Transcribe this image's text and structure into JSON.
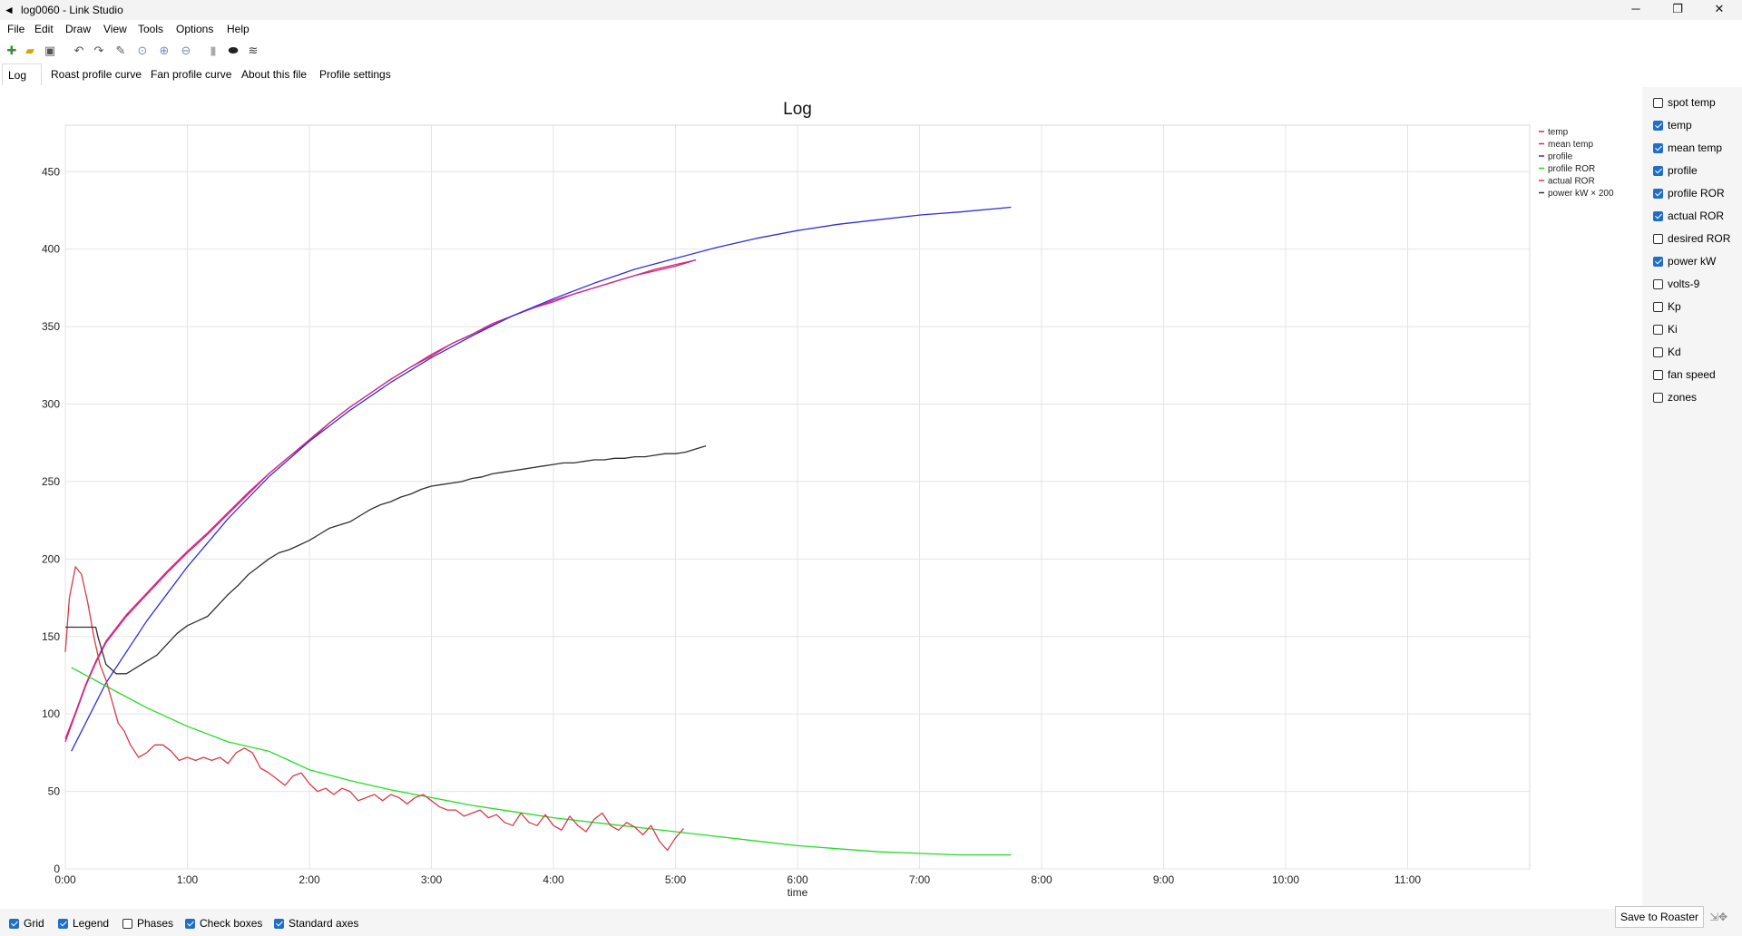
{
  "window": {
    "title": "log0060 - Link Studio",
    "app_icon": "back-arrow-icon",
    "minimize_glyph": "─",
    "maximize_glyph": "❐",
    "close_glyph": "✕"
  },
  "menu": [
    "File",
    "Edit",
    "Draw",
    "View",
    "Tools",
    "Options",
    "Help"
  ],
  "toolbar_icons": [
    "new-file-icon",
    "open-folder-icon",
    "save-icon",
    "undo-icon",
    "redo-icon",
    "tools-icon",
    "zoom-icon",
    "zoom-in-icon",
    "zoom-out-icon",
    "divider-icon",
    "bean-icon",
    "steam-icon"
  ],
  "tabs": [
    {
      "label": "Log",
      "active": true
    },
    {
      "label": "Roast profile curve",
      "active": false
    },
    {
      "label": "Fan profile curve",
      "active": false
    },
    {
      "label": "About this file",
      "active": false
    },
    {
      "label": "Profile settings",
      "active": false
    }
  ],
  "side_checkboxes": [
    {
      "label": "spot temp",
      "checked": false
    },
    {
      "label": "temp",
      "checked": true
    },
    {
      "label": "mean temp",
      "checked": true
    },
    {
      "label": "profile",
      "checked": true
    },
    {
      "label": "profile ROR",
      "checked": true
    },
    {
      "label": "actual ROR",
      "checked": true
    },
    {
      "label": "desired ROR",
      "checked": false
    },
    {
      "label": "power kW",
      "checked": true
    },
    {
      "label": "volts-9",
      "checked": false
    },
    {
      "label": "Kp",
      "checked": false
    },
    {
      "label": "Ki",
      "checked": false
    },
    {
      "label": "Kd",
      "checked": false
    },
    {
      "label": "fan speed",
      "checked": false
    },
    {
      "label": "zones",
      "checked": false
    }
  ],
  "status_checkboxes": [
    {
      "label": "Grid",
      "checked": true
    },
    {
      "label": "Legend",
      "checked": true
    },
    {
      "label": "Phases",
      "checked": false
    },
    {
      "label": "Check boxes",
      "checked": true
    },
    {
      "label": "Standard axes",
      "checked": true
    }
  ],
  "save_button": "Save to Roaster",
  "resize_icon": "resize-icon",
  "chart_data": {
    "type": "line",
    "title": "Log",
    "xlabel": "time",
    "ylabel": "",
    "xlim": [
      0,
      720
    ],
    "ylim": [
      0,
      480
    ],
    "x_ticks": [
      {
        "v": 0,
        "label": "0:00"
      },
      {
        "v": 60,
        "label": "1:00"
      },
      {
        "v": 120,
        "label": "2:00"
      },
      {
        "v": 180,
        "label": "3:00"
      },
      {
        "v": 240,
        "label": "4:00"
      },
      {
        "v": 300,
        "label": "5:00"
      },
      {
        "v": 360,
        "label": "6:00"
      },
      {
        "v": 420,
        "label": "7:00"
      },
      {
        "v": 480,
        "label": "8:00"
      },
      {
        "v": 540,
        "label": "9:00"
      },
      {
        "v": 600,
        "label": "10:00"
      },
      {
        "v": 660,
        "label": "11:00"
      }
    ],
    "y_ticks": [
      0,
      50,
      100,
      150,
      200,
      250,
      300,
      350,
      400,
      450
    ],
    "grid": true,
    "legend_position": "top-right",
    "series": [
      {
        "name": "temp",
        "color": "#e0206a",
        "x": [
          0,
          5,
          10,
          15,
          20,
          30,
          40,
          50,
          60,
          70,
          80,
          90,
          100,
          110,
          120,
          130,
          140,
          150,
          160,
          170,
          180,
          190,
          200,
          210,
          220,
          230,
          240,
          250,
          260,
          270,
          280,
          290,
          300,
          310
        ],
        "y": [
          82,
          100,
          118,
          133,
          146,
          163,
          177,
          191,
          204,
          216,
          229,
          242,
          255,
          266,
          276,
          288,
          298,
          307,
          316,
          324,
          331,
          339,
          345,
          351,
          357,
          362,
          366,
          371,
          375,
          379,
          383,
          386,
          389,
          393
        ]
      },
      {
        "name": "mean temp",
        "color": "#cc2a8a",
        "x": [
          0,
          5,
          10,
          15,
          20,
          30,
          40,
          50,
          60,
          70,
          80,
          90,
          100,
          110,
          120,
          130,
          140,
          150,
          160,
          170,
          180,
          190,
          200,
          210,
          220,
          230,
          240,
          250,
          260,
          270,
          280,
          290,
          300,
          310
        ],
        "y": [
          84,
          101,
          119,
          134,
          147,
          164,
          178,
          192,
          205,
          217,
          230,
          243,
          255,
          266,
          277,
          288,
          298,
          307,
          316,
          324,
          332,
          339,
          345,
          352,
          357,
          362,
          367,
          371,
          375,
          379,
          383,
          387,
          390,
          393
        ]
      },
      {
        "name": "profile",
        "color": "#2e2ee6",
        "x": [
          3,
          20,
          40,
          60,
          80,
          100,
          120,
          140,
          160,
          180,
          200,
          220,
          240,
          260,
          280,
          300,
          320,
          340,
          360,
          380,
          400,
          420,
          440,
          465
        ],
        "y": [
          76,
          120,
          160,
          195,
          226,
          253,
          276,
          296,
          314,
          330,
          344,
          357,
          368,
          378,
          387,
          394,
          401,
          407,
          412,
          416,
          419,
          422,
          424,
          427
        ]
      },
      {
        "name": "profile ROR",
        "color": "#22dd22",
        "x": [
          3,
          20,
          40,
          60,
          80,
          100,
          110,
          120,
          140,
          160,
          180,
          200,
          220,
          240,
          260,
          280,
          300,
          320,
          340,
          360,
          380,
          400,
          420,
          440,
          465
        ],
        "y": [
          130,
          118,
          104,
          92,
          82,
          76,
          70,
          64,
          57,
          51,
          46,
          41,
          37,
          33,
          30,
          27,
          24,
          21,
          18,
          15,
          13,
          11,
          10,
          9,
          9
        ]
      },
      {
        "name": "actual ROR",
        "color": "#d83a4a",
        "x": [
          0,
          2,
          5,
          8,
          11,
          14,
          17,
          20,
          23,
          26,
          29,
          32,
          36,
          40,
          44,
          48,
          52,
          56,
          60,
          64,
          68,
          72,
          76,
          80,
          84,
          88,
          92,
          96,
          100,
          104,
          108,
          112,
          116,
          120,
          124,
          128,
          132,
          136,
          140,
          144,
          148,
          152,
          156,
          160,
          164,
          168,
          172,
          176,
          180,
          184,
          188,
          192,
          196,
          200,
          204,
          208,
          212,
          216,
          220,
          224,
          228,
          232,
          236,
          240,
          244,
          248,
          252,
          256,
          260,
          264,
          268,
          272,
          276,
          280,
          284,
          288,
          292,
          296,
          300,
          304
        ],
        "y": [
          140,
          175,
          195,
          190,
          172,
          150,
          132,
          122,
          108,
          94,
          89,
          80,
          72,
          75,
          80,
          80,
          76,
          70,
          72,
          70,
          72,
          70,
          72,
          68,
          75,
          78,
          75,
          65,
          62,
          58,
          54,
          60,
          62,
          55,
          50,
          52,
          48,
          52,
          50,
          44,
          46,
          48,
          44,
          48,
          46,
          42,
          46,
          48,
          44,
          40,
          38,
          38,
          34,
          36,
          38,
          33,
          35,
          30,
          28,
          36,
          30,
          28,
          35,
          28,
          25,
          34,
          28,
          24,
          32,
          36,
          28,
          25,
          30,
          27,
          22,
          28,
          18,
          12,
          20,
          26
        ]
      },
      {
        "name": "power kW × 200",
        "color": "#303030",
        "x": [
          0,
          15,
          16,
          20,
          25,
          30,
          35,
          40,
          45,
          50,
          55,
          60,
          65,
          70,
          75,
          80,
          85,
          90,
          95,
          100,
          105,
          110,
          115,
          120,
          125,
          130,
          135,
          140,
          145,
          150,
          155,
          160,
          165,
          170,
          175,
          180,
          185,
          190,
          195,
          200,
          205,
          210,
          215,
          220,
          225,
          230,
          235,
          240,
          245,
          250,
          255,
          260,
          265,
          270,
          275,
          280,
          285,
          290,
          295,
          300,
          305,
          310,
          315
        ],
        "y": [
          156,
          156,
          150,
          132,
          126,
          126,
          130,
          134,
          138,
          145,
          152,
          157,
          160,
          163,
          170,
          177,
          183,
          190,
          195,
          200,
          204,
          206,
          209,
          212,
          216,
          220,
          222,
          224,
          228,
          232,
          235,
          237,
          240,
          242,
          245,
          247,
          248,
          249,
          250,
          252,
          253,
          255,
          256,
          257,
          258,
          259,
          260,
          261,
          262,
          262,
          263,
          264,
          264,
          265,
          265,
          266,
          266,
          267,
          268,
          268,
          269,
          271,
          273
        ]
      }
    ]
  }
}
